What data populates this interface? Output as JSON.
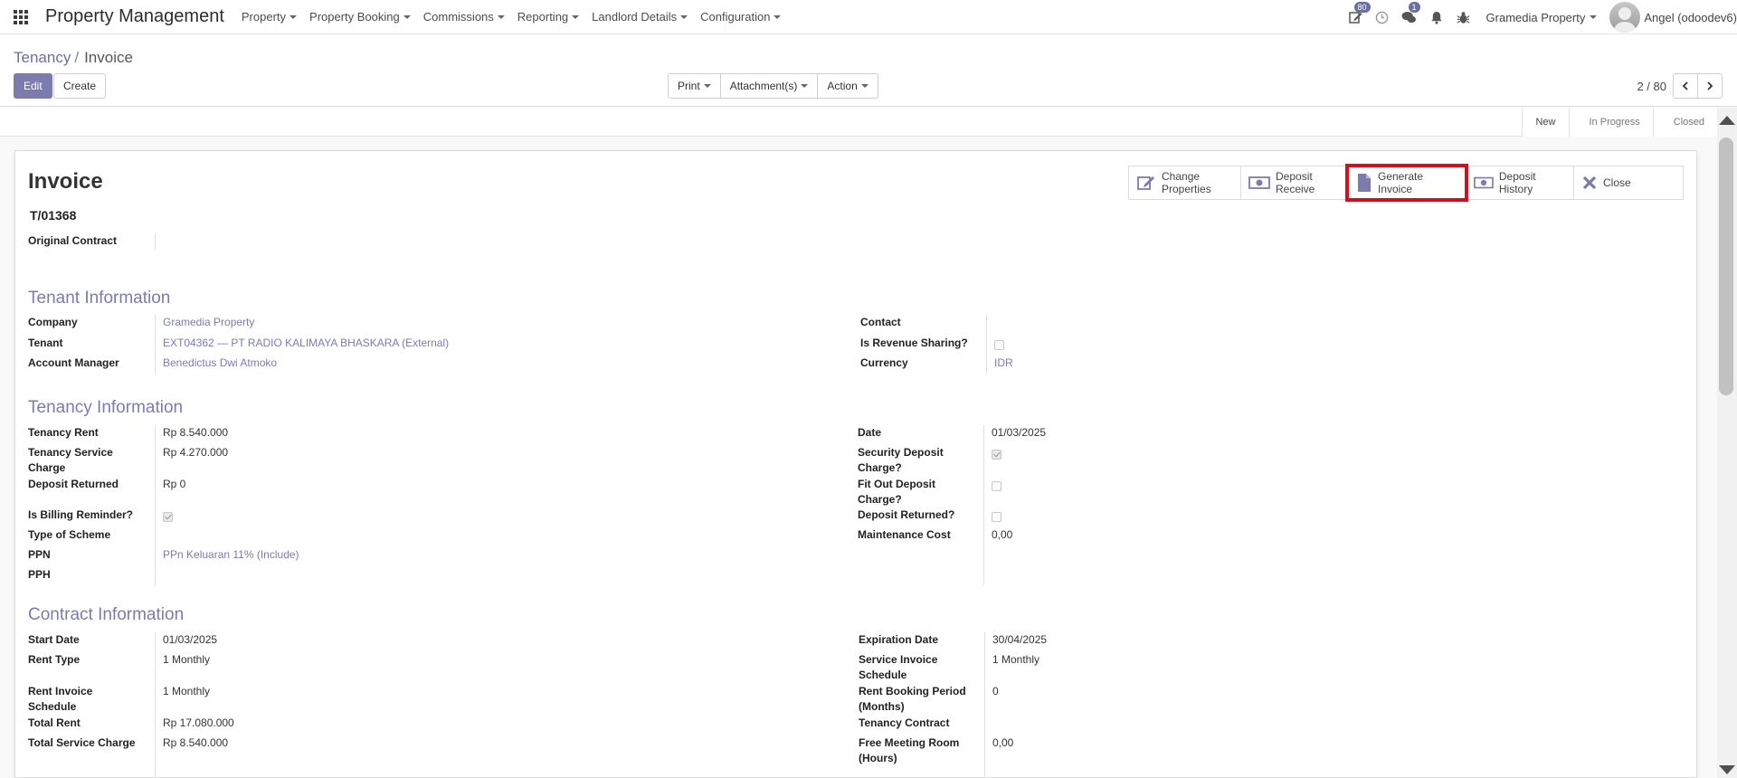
{
  "navbar": {
    "brand": "Property Management",
    "menu": [
      {
        "label": "Property"
      },
      {
        "label": "Property Booking"
      },
      {
        "label": "Commissions"
      },
      {
        "label": "Reporting"
      },
      {
        "label": "Landlord Details"
      },
      {
        "label": "Configuration"
      }
    ],
    "activity_badge": "80",
    "messages_badge": "1",
    "company": "Gramedia Property",
    "user": "Angel (odoodev6)"
  },
  "control": {
    "breadcrumb_parent": "Tenancy",
    "breadcrumb_current": "Invoice",
    "edit_label": "Edit",
    "create_label": "Create",
    "print_label": "Print",
    "attachments_label": "Attachment(s)",
    "action_label": "Action",
    "pager": "2 / 80"
  },
  "stages": [
    "New",
    "In Progress",
    "Closed"
  ],
  "buttons": {
    "change_properties": [
      "Change",
      "Properties"
    ],
    "deposit_receive": [
      "Deposit",
      "Receive"
    ],
    "generate_invoice": [
      "Generate",
      "Invoice"
    ],
    "deposit_history": "Deposit History",
    "close": "Close"
  },
  "form": {
    "title": "Invoice",
    "number": "T/01368",
    "original_contract_label": "Original Contract",
    "tenant_section": "Tenant Information",
    "company_label": "Company",
    "company_value": "Gramedia Property",
    "tenant_label": "Tenant",
    "tenant_value": "EXT04362 — PT RADIO KALIMAYA BHASKARA (External)",
    "account_manager_label": "Account Manager",
    "account_manager_value": "Benedictus Dwi Atmoko",
    "contact_label": "Contact",
    "revenue_sharing_label": "Is Revenue Sharing?",
    "currency_label": "Currency",
    "currency_value": "IDR",
    "tenancy_section": "Tenancy Information",
    "tenancy_rent_label": "Tenancy Rent",
    "tenancy_rent_value": "Rp 8.540.000",
    "service_charge_label_1": "Tenancy Service",
    "service_charge_label_2": "Charge",
    "service_charge_value": "Rp 4.270.000",
    "deposit_returned_label": "Deposit Returned",
    "deposit_returned_value": "Rp 0",
    "billing_reminder_label": "Is Billing Reminder?",
    "type_scheme_label": "Type of Scheme",
    "ppn_label": "PPN",
    "ppn_value": "PPn Keluaran 11% (Include)",
    "pph_label": "PPH",
    "date_label": "Date",
    "date_value": "01/03/2025",
    "security_deposit_label_1": "Security Deposit",
    "security_deposit_label_2": "Charge?",
    "fitout_deposit_label_1": "Fit Out Deposit",
    "fitout_deposit_label_2": "Charge?",
    "deposit_returned_q_label": "Deposit Returned?",
    "maintenance_cost_label": "Maintenance Cost",
    "maintenance_cost_value": "0,00",
    "contract_section": "Contract Information",
    "start_date_label": "Start Date",
    "start_date_value": "01/03/2025",
    "rent_type_label": "Rent Type",
    "rent_type_value": "1 Monthly",
    "rent_invoice_schedule_label_1": "Rent Invoice",
    "rent_invoice_schedule_label_2": "Schedule",
    "rent_invoice_schedule_value": "1 Monthly",
    "total_rent_label": "Total Rent",
    "total_rent_value": "Rp 17.080.000",
    "total_service_label": "Total Service Charge",
    "total_service_value": "Rp 8.540.000",
    "expiration_date_label": "Expiration Date",
    "expiration_date_value": "30/04/2025",
    "service_invoice_label_1": "Service Invoice",
    "service_invoice_label_2": "Schedule",
    "service_invoice_value": "1 Monthly",
    "rent_booking_period_label_1": "Rent Booking Period",
    "rent_booking_period_label_2": "(Months)",
    "rent_booking_period_value": "0",
    "tenancy_contract_label": "Tenancy Contract",
    "free_meeting_label_1": "Free Meeting Room",
    "free_meeting_label_2": "(Hours)",
    "free_meeting_value": "0,00"
  },
  "checkboxes": {
    "revenue_sharing": false,
    "billing_reminder": true,
    "security_deposit": true,
    "fitout_deposit": false,
    "deposit_returned": false
  }
}
